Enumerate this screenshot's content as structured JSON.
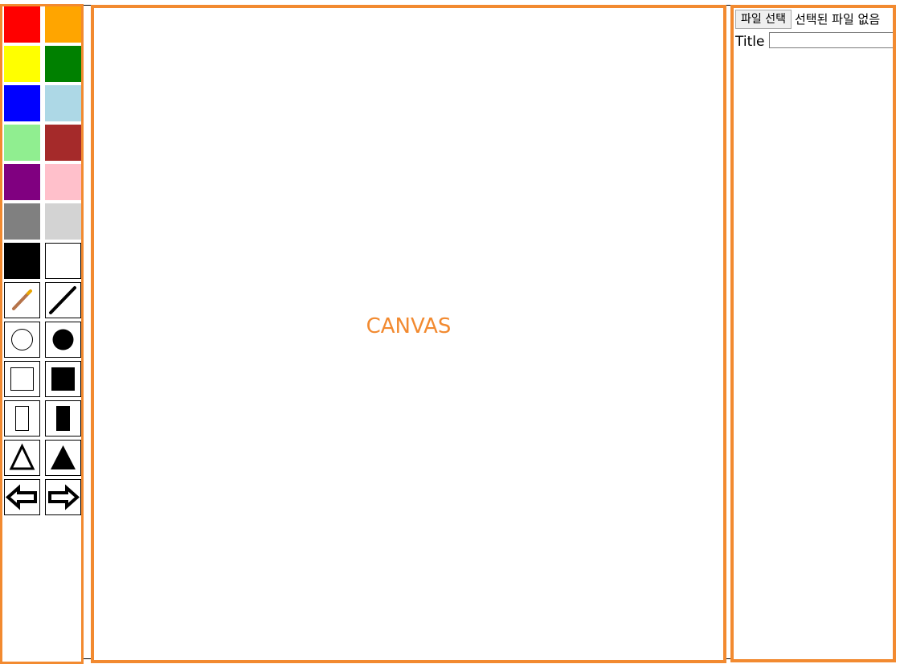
{
  "palette": {
    "colors": [
      "#ff0000",
      "#ffa500",
      "#ffff00",
      "#008000",
      "#0000ff",
      "#add8e6",
      "#90ee90",
      "#a52a2a",
      "#800080",
      "#ffc0cb",
      "#808080",
      "#d3d3d3",
      "#000000",
      "#ffffff"
    ]
  },
  "tools": [
    {
      "name": "pencil-tool",
      "icon": "pencil-icon"
    },
    {
      "name": "line-tool",
      "icon": "line-icon"
    },
    {
      "name": "circle-outline-tool",
      "icon": "circle-outline-icon"
    },
    {
      "name": "circle-filled-tool",
      "icon": "circle-filled-icon"
    },
    {
      "name": "square-outline-tool",
      "icon": "square-outline-icon"
    },
    {
      "name": "square-filled-tool",
      "icon": "square-filled-icon"
    },
    {
      "name": "rectangle-outline-tool",
      "icon": "rectangle-outline-icon"
    },
    {
      "name": "rectangle-filled-tool",
      "icon": "rectangle-filled-icon"
    },
    {
      "name": "triangle-outline-tool",
      "icon": "triangle-outline-icon"
    },
    {
      "name": "triangle-filled-tool",
      "icon": "triangle-filled-icon"
    },
    {
      "name": "undo-arrow-tool",
      "icon": "arrow-left-icon"
    },
    {
      "name": "redo-arrow-tool",
      "icon": "arrow-right-icon"
    }
  ],
  "canvas": {
    "label": "CANVAS"
  },
  "file": {
    "button_label": "파일 선택",
    "status": "선택된 파일 없음"
  },
  "title_field": {
    "label": "Title",
    "value": ""
  },
  "colors": {
    "panel_border": "#f28a30",
    "canvas_label": "#f28a30"
  }
}
